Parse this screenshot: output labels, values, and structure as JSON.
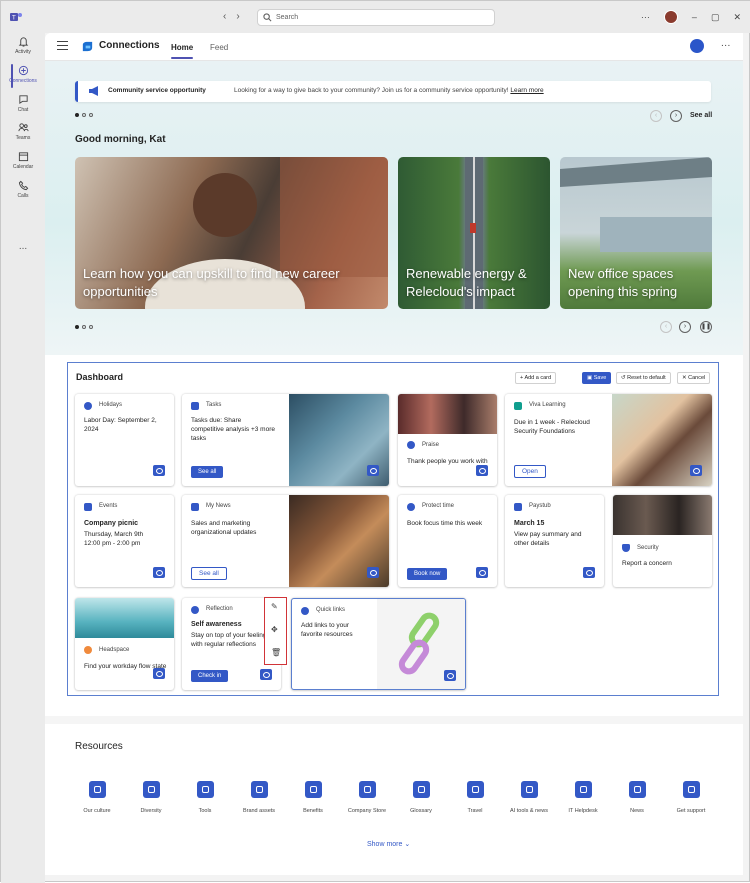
{
  "titlebar": {
    "search_placeholder": "Search"
  },
  "rail": {
    "items": [
      {
        "label": "Activity",
        "icon": "bell-icon"
      },
      {
        "label": "Connections",
        "icon": "connections-icon"
      },
      {
        "label": "Chat",
        "icon": "chat-icon"
      },
      {
        "label": "Teams",
        "icon": "teams-icon"
      },
      {
        "label": "Calendar",
        "icon": "calendar-icon"
      },
      {
        "label": "Calls",
        "icon": "phone-icon"
      }
    ],
    "more": "..."
  },
  "app": {
    "title": "Connections",
    "tabs": [
      {
        "label": "Home"
      },
      {
        "label": "Feed"
      }
    ],
    "more": "..."
  },
  "hero": {
    "banner": {
      "title": "Community service opportunity",
      "text": "Looking for a way to give back to your community? Join us for a community service opportunity!",
      "link": "Learn more"
    },
    "see_all": "See all",
    "greeting": "Good morning, Kat",
    "cards": [
      {
        "caption": "Learn how you can upskill to find new career opportunities"
      },
      {
        "caption": "Renewable energy & Relecloud's impact"
      },
      {
        "caption": "New office spaces opening this spring"
      }
    ]
  },
  "dashboard": {
    "title": "Dashboard",
    "add_card": "Add a card",
    "save": "Save",
    "reset": "Reset to default",
    "cancel": "Cancel",
    "holidays": {
      "label": "Holidays",
      "text": "Labor Day: September 2, 2024"
    },
    "tasks": {
      "label": "Tasks",
      "text": "Tasks due: Share competitive analysis +3 more tasks",
      "button": "See all"
    },
    "praise": {
      "label": "Praise",
      "text": "Thank people you work with"
    },
    "viva": {
      "label": "Viva Learning",
      "text": "Due in 1 week - Relecloud Security Foundations",
      "button": "Open"
    },
    "events": {
      "label": "Events",
      "title": "Company picnic",
      "date": "Thursday, March 9th",
      "time": "12:00 pm - 2:00 pm"
    },
    "news": {
      "label": "My News",
      "text": "Sales and marketing organizational updates",
      "button": "See all"
    },
    "protect": {
      "label": "Protect time",
      "text": "Book focus time this week",
      "button": "Book now"
    },
    "paystub": {
      "label": "Paystub",
      "title": "March 15",
      "text": "View pay summary and other details"
    },
    "security": {
      "label": "Security",
      "text": "Report a concern"
    },
    "headspace": {
      "label": "Headspace",
      "text": "Find your workday flow state"
    },
    "reflection": {
      "label": "Reflection",
      "title": "Self awareness",
      "text": "Stay on top of your feelings with regular reflections",
      "button": "Check in"
    },
    "quicklinks": {
      "label": "Quick links",
      "text": "Add links to your favorite resources"
    }
  },
  "resources": {
    "title": "Resources",
    "items": [
      {
        "label": "Our culture"
      },
      {
        "label": "Diversity"
      },
      {
        "label": "Tools"
      },
      {
        "label": "Brand assets"
      },
      {
        "label": "Benefits"
      },
      {
        "label": "Company Store"
      },
      {
        "label": "Glossary"
      },
      {
        "label": "Travel"
      },
      {
        "label": "AI tools & news"
      },
      {
        "label": "IT Helpdesk"
      },
      {
        "label": "News"
      },
      {
        "label": "Get support"
      }
    ],
    "show_more": "Show more"
  }
}
